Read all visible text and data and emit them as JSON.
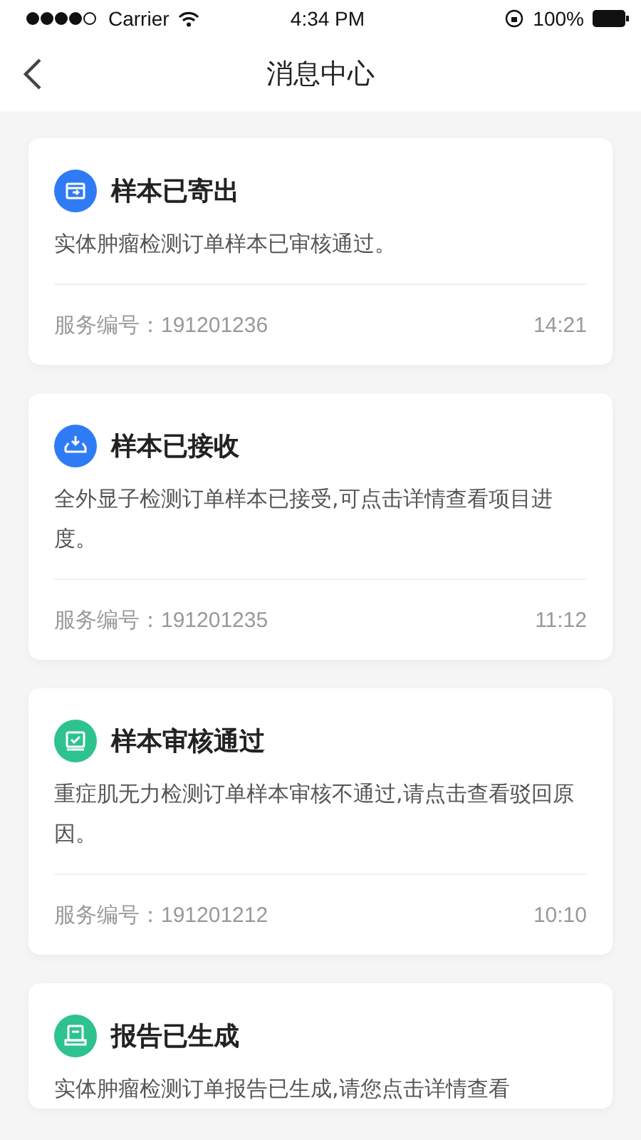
{
  "status_bar": {
    "carrier": "Carrier",
    "time": "4:34 PM",
    "battery": "100%"
  },
  "nav": {
    "title": "消息中心"
  },
  "messages": [
    {
      "kind": "shipped",
      "color": "#2f7bf5",
      "title": "样本已寄出",
      "body": "实体肿瘤检测订单样本已审核通过。",
      "service": "服务编号：191201236",
      "time": "14:21"
    },
    {
      "kind": "received",
      "color": "#2f7bf5",
      "title": "样本已接收",
      "body": "全外显子检测订单样本已接受,可点击详情查看项目进度。",
      "service": "服务编号：191201235",
      "time": "11:12"
    },
    {
      "kind": "review",
      "color": "#2ec28f",
      "title": "样本审核通过",
      "body": "重症肌无力检测订单样本审核不通过,请点击查看驳回原因。",
      "service": "服务编号：191201212",
      "time": "10:10"
    },
    {
      "kind": "report",
      "color": "#2ec28f",
      "title": "报告已生成",
      "body": "实体肿瘤检测订单报告已生成,请您点击详情查看"
    }
  ]
}
